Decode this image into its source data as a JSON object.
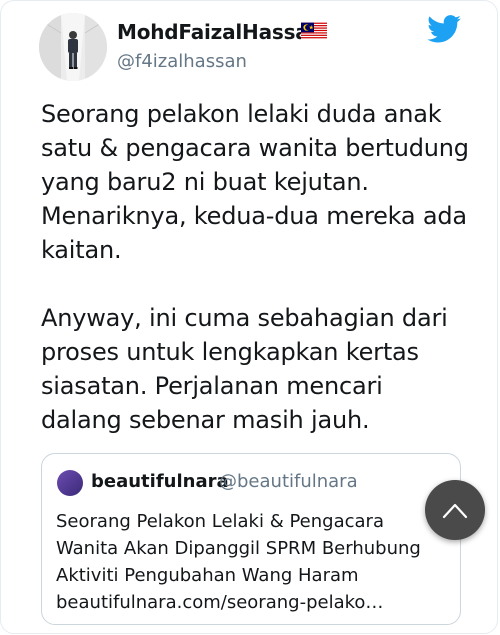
{
  "author": {
    "display_name": "MohdFaizalHassan",
    "handle": "@f4izalhassan",
    "flag_icon": "malaysia-flag-icon"
  },
  "tweet": {
    "lines": [
      "Seorang pelakon lelaki duda anak",
      "satu & pengacara wanita bertudung",
      "yang baru2 ni buat kejutan.",
      "Menariknya, kedua-dua mereka ada",
      "kaitan.",
      "Anyway, ini cuma sebahagian dari",
      "proses untuk lengkapkan kertas",
      "siasatan. Perjalanan mencari",
      "dalang sebenar masih jauh."
    ]
  },
  "quoted_tweet": {
    "name": "beautifulnara",
    "handle": "@beautifulnara",
    "lines": [
      "Seorang Pelakon Lelaki & Pengacara",
      "Wanita Akan Dipanggil SPRM Berhubung",
      "Aktiviti Pengubahan Wang Haram"
    ],
    "link": "beautifulnara.com/seorang-pelako…"
  },
  "icons": {
    "brand": "twitter-bird-icon",
    "fab": "chevron-up-icon"
  },
  "colors": {
    "twitter_blue": "#1da1f2",
    "text": "#14171a",
    "secondary": "#657786",
    "fab": "#4a4a4a"
  }
}
